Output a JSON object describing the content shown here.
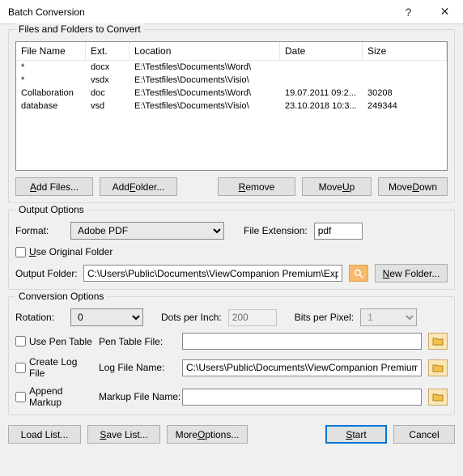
{
  "window": {
    "title": "Batch Conversion",
    "help": "?",
    "close": "✕"
  },
  "files_group": {
    "legend": "Files and Folders to Convert",
    "headers": {
      "name": "File Name",
      "ext": "Ext.",
      "loc": "Location",
      "date": "Date",
      "size": "Size"
    },
    "rows": [
      {
        "name": "*",
        "ext": "docx",
        "loc": "E:\\Testfiles\\Documents\\Word\\",
        "date": "",
        "size": ""
      },
      {
        "name": "*",
        "ext": "vsdx",
        "loc": "E:\\Testfiles\\Documents\\Visio\\",
        "date": "",
        "size": ""
      },
      {
        "name": "Collaboration",
        "ext": "doc",
        "loc": "E:\\Testfiles\\Documents\\Word\\",
        "date": "19.07.2011  09:2...",
        "size": "30208"
      },
      {
        "name": "database",
        "ext": "vsd",
        "loc": "E:\\Testfiles\\Documents\\Visio\\",
        "date": "23.10.2018  10:3...",
        "size": "249344"
      }
    ],
    "buttons": {
      "add_files_pre": "",
      "add_files_u": "A",
      "add_files_post": "dd Files...",
      "add_folder_pre": "Add ",
      "add_folder_u": "F",
      "add_folder_post": "older...",
      "remove_u": "R",
      "remove_post": "emove",
      "move_up_pre": "Move ",
      "move_up_u": "U",
      "move_up_post": "p",
      "move_down_pre": "Move ",
      "move_down_u": "D",
      "move_down_post": "own"
    }
  },
  "output_group": {
    "legend": "Output Options",
    "format_label": "Format:",
    "format_value": "Adobe PDF",
    "file_ext_label": "File Extension:",
    "file_ext_value": "pdf",
    "use_original_u": "U",
    "use_original_post": "se Original Folder",
    "output_folder_label": "Output Folder:",
    "output_folder_value": "C:\\Users\\Public\\Documents\\ViewCompanion Premium\\Export",
    "new_folder_u": "N",
    "new_folder_post": "ew Folder..."
  },
  "conv_group": {
    "legend": "Conversion Options",
    "rotation_label": "Rotation:",
    "rotation_value": "0",
    "dpi_label": "Dots per Inch:",
    "dpi_value": "200",
    "bpp_label": "Bits per Pixel:",
    "bpp_value": "1",
    "use_pen_table": "Use Pen Table",
    "pen_table_file_label": "Pen Table File:",
    "pen_table_file_value": "",
    "create_log": "Create Log File",
    "log_file_label": "Log File Name:",
    "log_file_value": "C:\\Users\\Public\\Documents\\ViewCompanion Premium\\Rep",
    "append_markup": "Append Markup",
    "markup_file_label": "Markup File Name:",
    "markup_file_value": ""
  },
  "bottom": {
    "load_list": "Load List...",
    "save_list_u": "S",
    "save_list_post": "ave List...",
    "more_options_pre": "More ",
    "more_options_u": "O",
    "more_options_post": "ptions...",
    "start_u": "S",
    "start_post": "tart",
    "cancel": "Cancel"
  }
}
